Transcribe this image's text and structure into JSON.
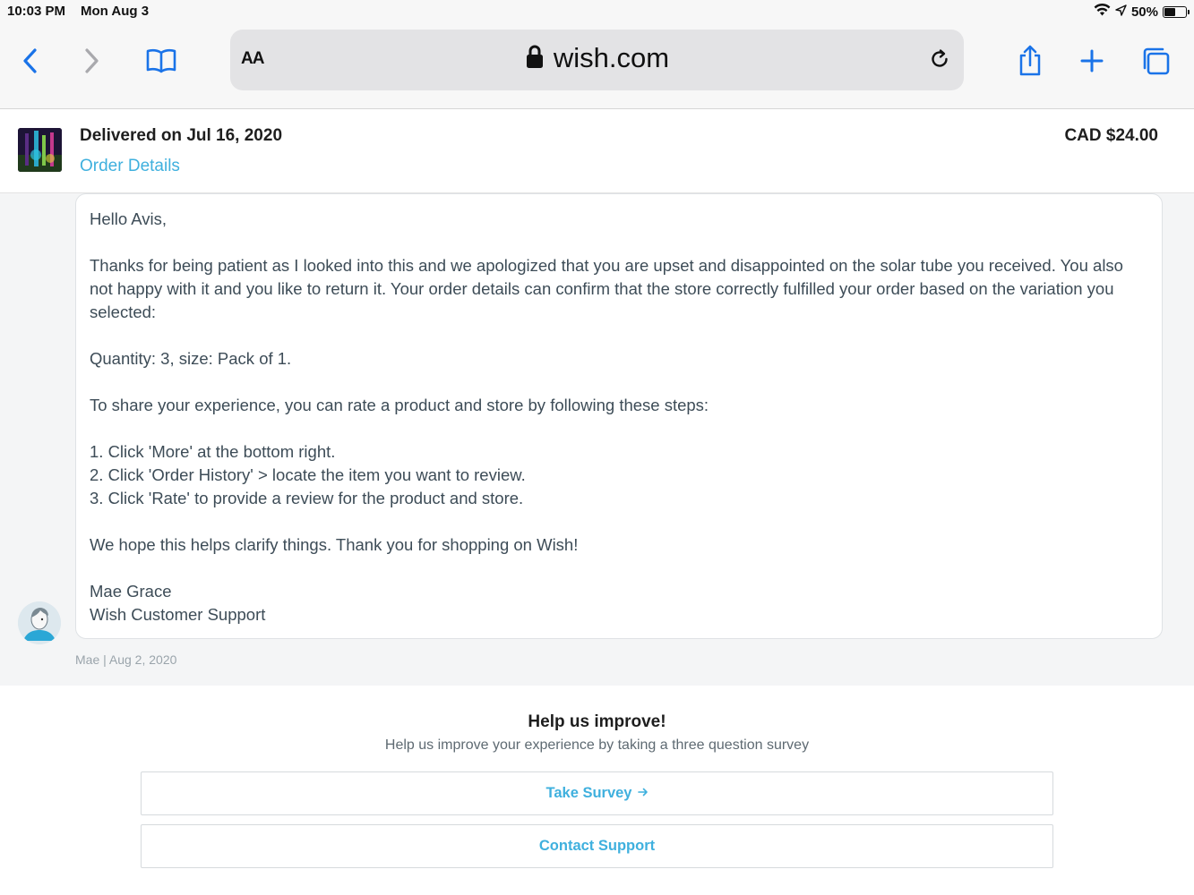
{
  "status_bar": {
    "time": "10:03 PM",
    "date": "Mon Aug 3",
    "battery": "50%",
    "battery_level": 0.5,
    "icons": [
      "wifi-icon",
      "location-icon",
      "battery-icon"
    ]
  },
  "browser": {
    "text_size_label": "AA",
    "url": "wish.com",
    "icons": [
      "back-icon",
      "forward-icon",
      "bookmarks-icon",
      "lock-icon",
      "reload-icon",
      "share-icon",
      "new-tab-icon",
      "tabs-icon"
    ],
    "accent_color": "#1a73e8"
  },
  "order": {
    "status": "Delivered on Jul 16, 2020",
    "details_link": "Order Details",
    "price": "CAD $24.00"
  },
  "message": {
    "greeting": "Hello Avis,",
    "paragraph1": "Thanks for being patient as I looked into this and we apologized that you are upset and disappointed on the solar tube you received. You also not happy with it and you like to return it. Your order details can confirm that the store correctly fulfilled your order based on the variation you selected:",
    "variation": "Quantity: 3, size: Pack of 1.",
    "intro_steps": "To share your experience, you can rate a product and store by following these steps:",
    "steps": [
      "1. Click 'More' at the bottom right.",
      "2. Click 'Order History' > locate the item you want to review.",
      "3. Click 'Rate' to provide a review for the product and store."
    ],
    "closing": "We hope this helps clarify things. Thank you for shopping on Wish!",
    "signature_name": "Mae Grace",
    "signature_team": "Wish Customer Support",
    "meta": "Mae | Aug 2, 2020"
  },
  "survey": {
    "title": "Help us improve!",
    "subtitle": "Help us improve your experience by taking a three question survey",
    "take_survey": "Take Survey",
    "contact_support": "Contact Support",
    "link_color": "#3fb0de"
  }
}
